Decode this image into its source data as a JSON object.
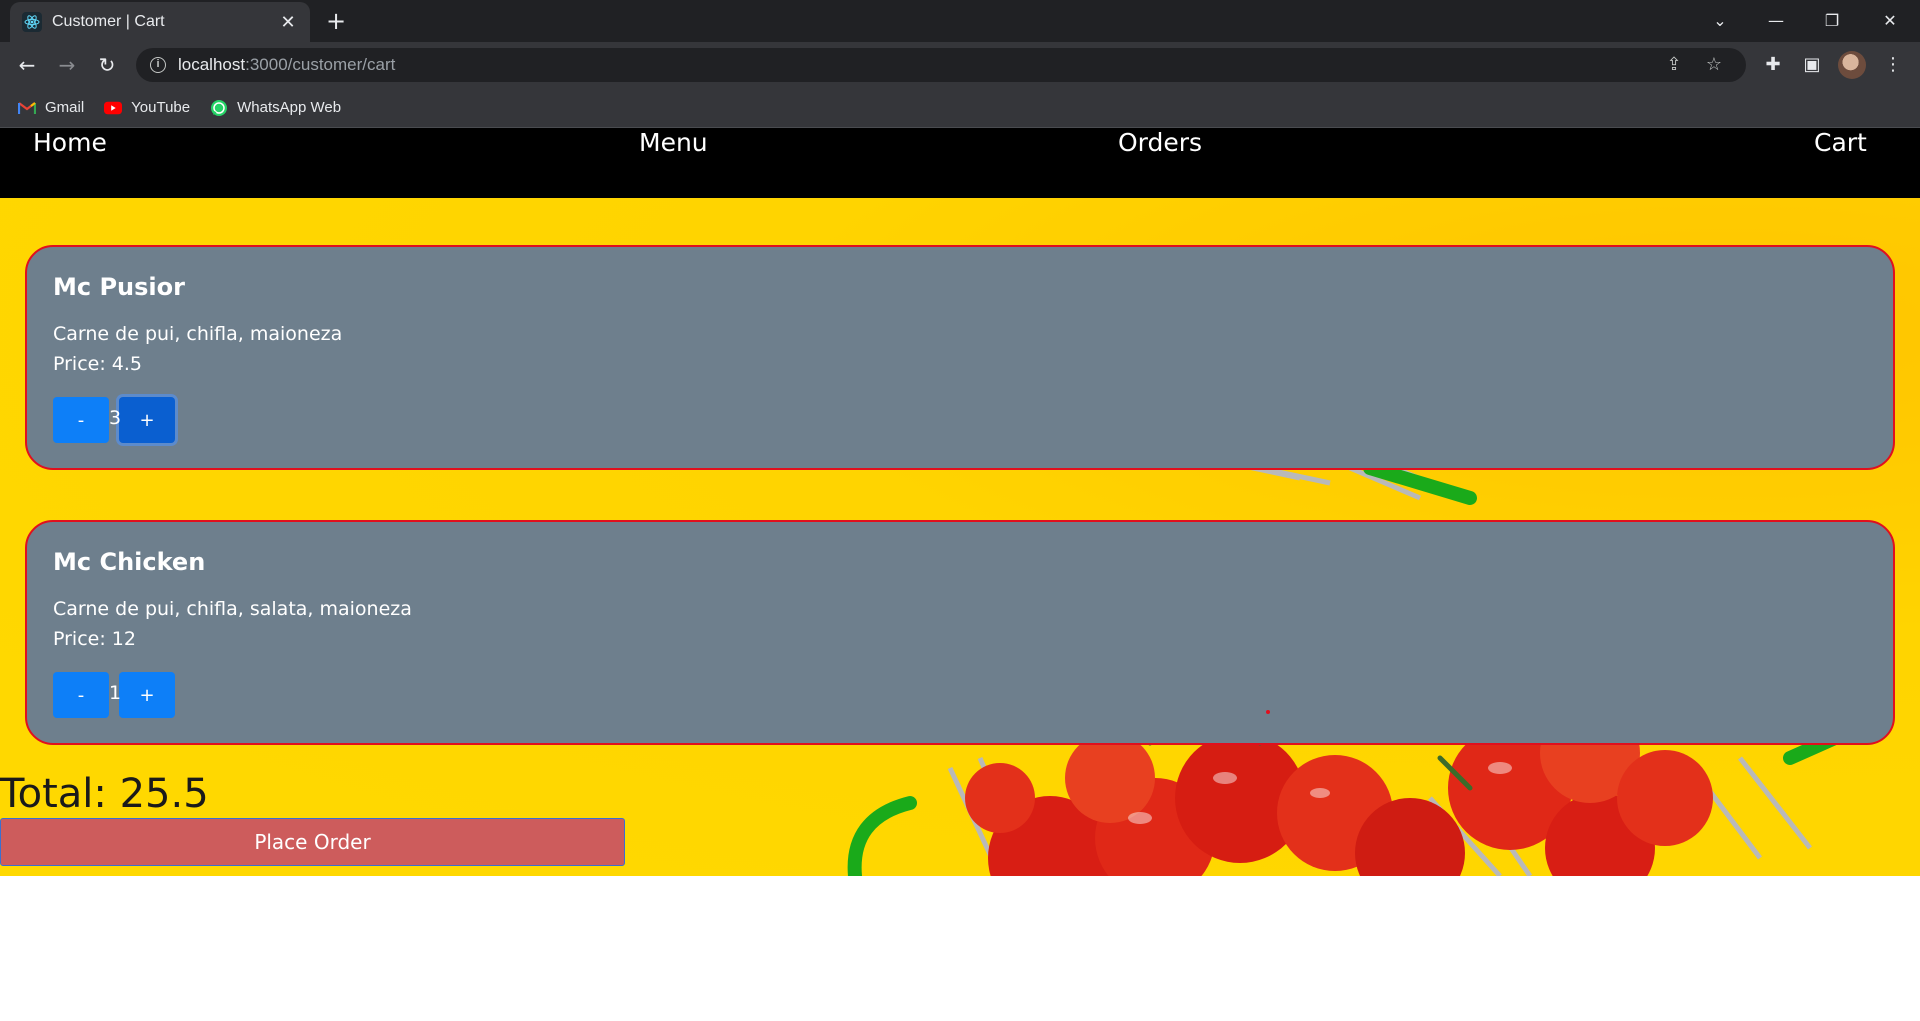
{
  "browser": {
    "tab_title": "Customer | Cart",
    "new_tab_icon": "plus-icon",
    "url_host": "localhost",
    "url_path": ":3000/customer/cart",
    "bookmarks": [
      {
        "label": "Gmail",
        "icon": "gmail-icon"
      },
      {
        "label": "YouTube",
        "icon": "youtube-icon"
      },
      {
        "label": "WhatsApp Web",
        "icon": "whatsapp-icon"
      }
    ],
    "colors": {
      "tabstrip": "#202124",
      "toolbar": "#35363a"
    }
  },
  "navbar": {
    "home": "Home",
    "menu": "Menu",
    "orders": "Orders",
    "cart": "Cart"
  },
  "cart": {
    "items": [
      {
        "name": "Mc Pusior",
        "description": "Carne de pui, chifla, maioneza",
        "price_text": "Price: 4.5",
        "quantity": "3",
        "minus": "-",
        "plus": "+"
      },
      {
        "name": "Mc Chicken",
        "description": "Carne de pui, chifla, salata, maioneza",
        "price_text": "Price: 12",
        "quantity": "1",
        "minus": "-",
        "plus": "+"
      }
    ],
    "total_text": "Total: 25.5",
    "place_order_label": "Place Order"
  },
  "colors": {
    "navbar_bg": "#000000",
    "hero_bg": "#ffd400",
    "card_bg": "#6e7f8d",
    "card_border": "#e0101e",
    "qty_button": "#0d7ff8",
    "place_order_bg": "#cd5c5c"
  }
}
